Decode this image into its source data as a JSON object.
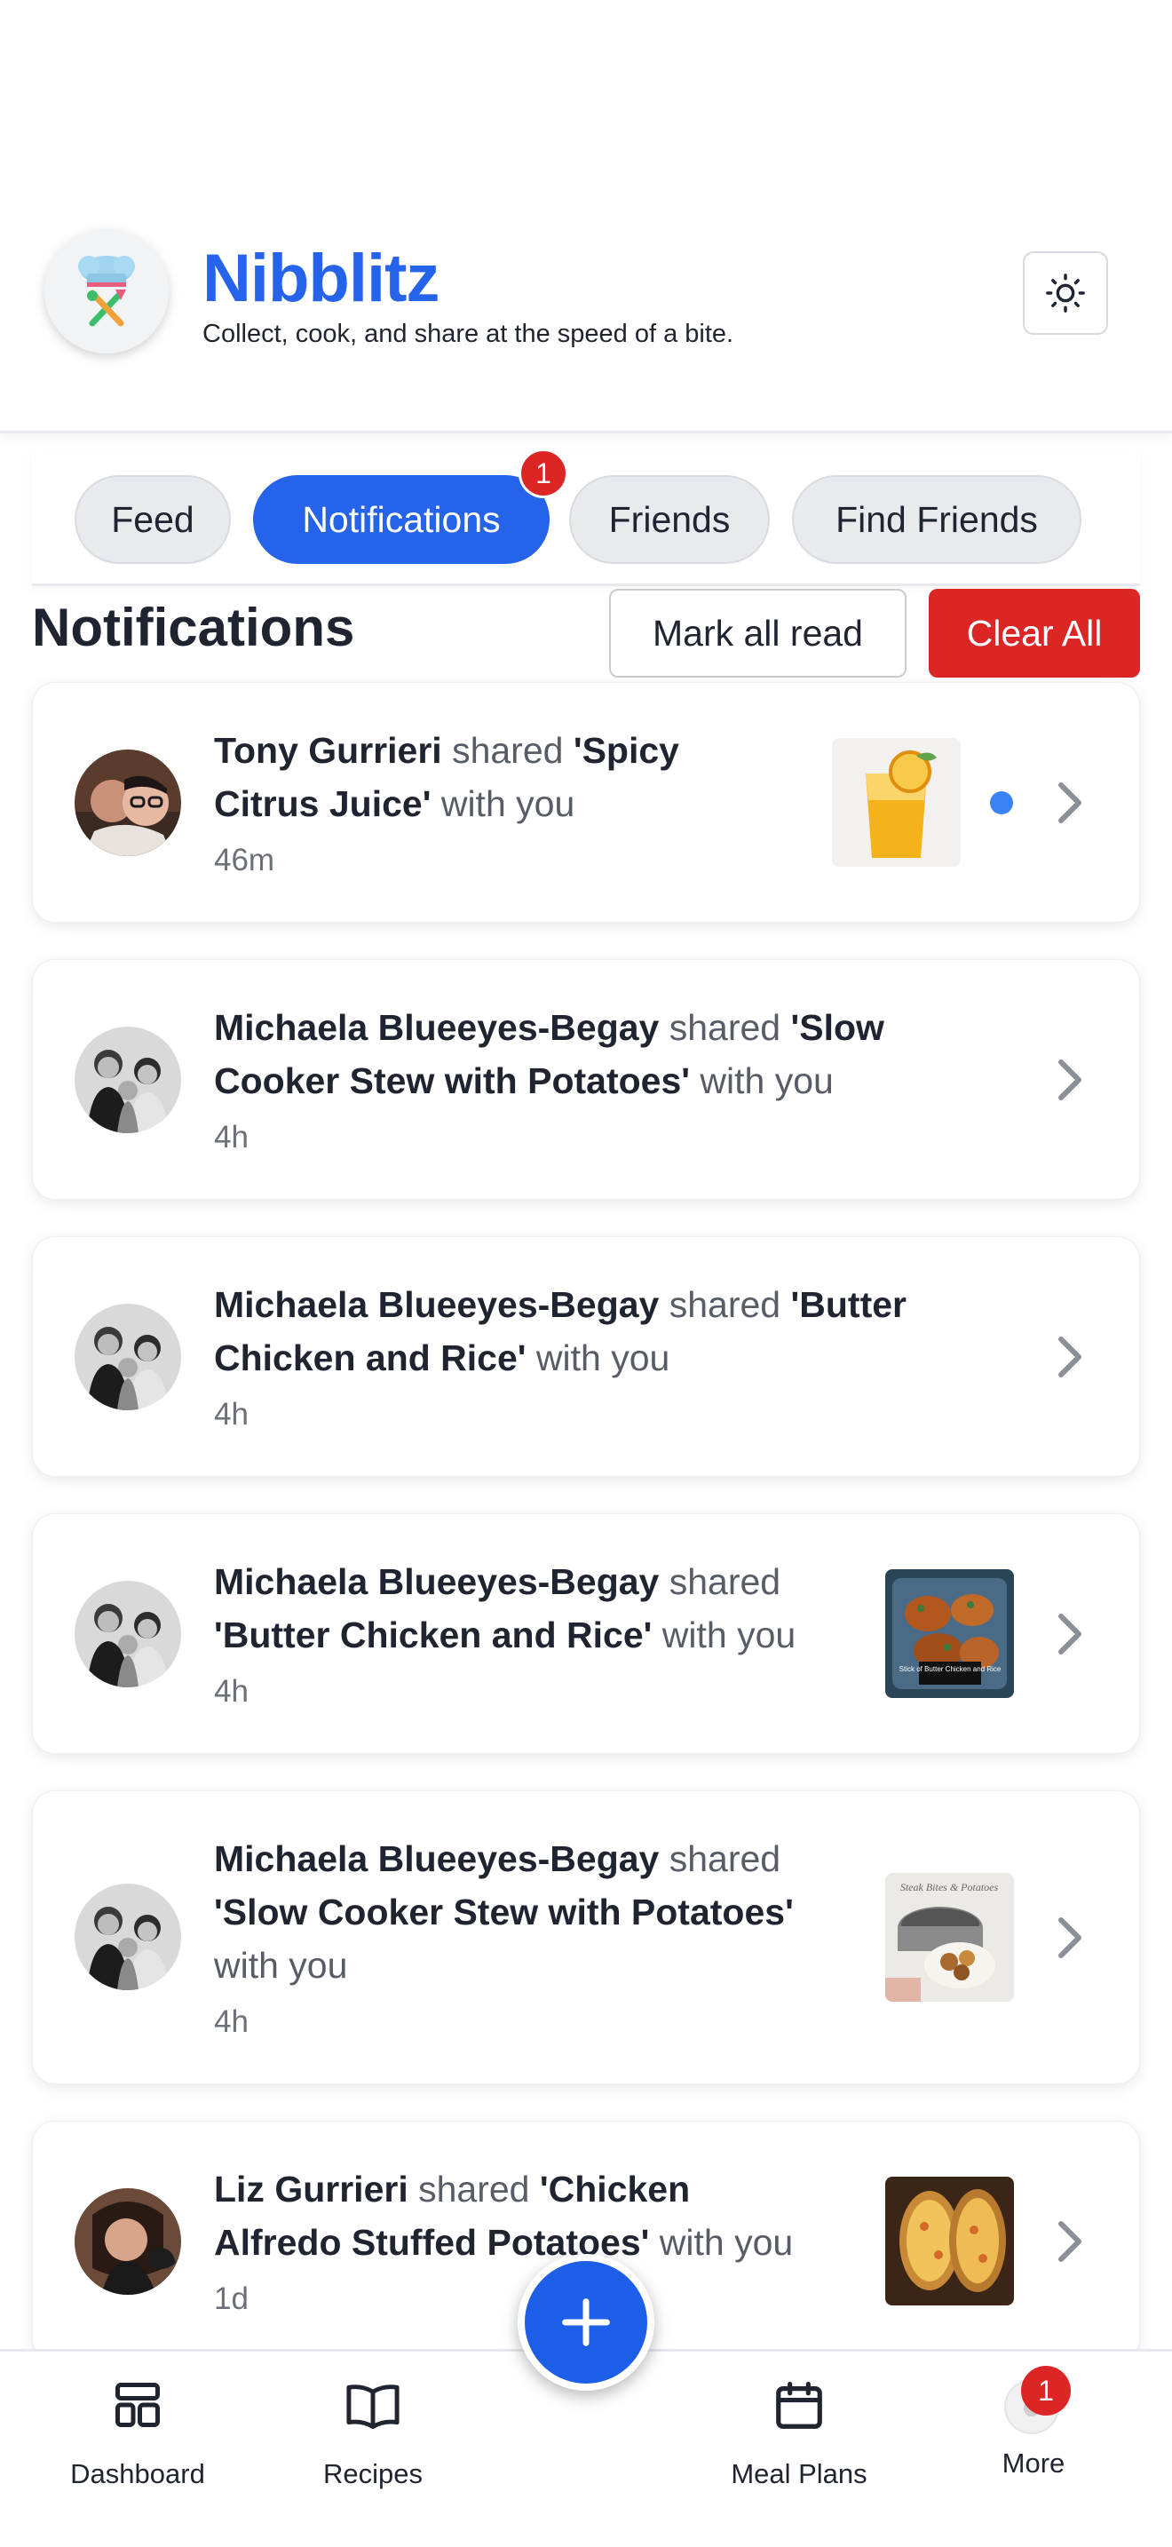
{
  "app": {
    "title": "Nibblitz",
    "subtitle": "Collect, cook, and share at the speed of a bite."
  },
  "tabs": [
    {
      "label": "Feed",
      "active": false
    },
    {
      "label": "Notifications",
      "active": true,
      "badge": "1"
    },
    {
      "label": "Friends",
      "active": false
    },
    {
      "label": "Find Friends",
      "active": false
    }
  ],
  "section": {
    "title": "Notifications",
    "mark_all_read": "Mark all read",
    "clear_all": "Clear All"
  },
  "notifications": [
    {
      "user": "Tony Gurrieri",
      "verb": " shared ",
      "recipe": "'Spicy",
      "recipe2": "Citrus Juice'",
      "suffix": " with you",
      "time": "46m",
      "unread": true
    },
    {
      "user": "Michaela Blueeyes-Begay",
      "verb": " shared ",
      "recipe": "'Slow",
      "recipe2": "Cooker Stew with Potatoes'",
      "suffix": " with you",
      "time": "4h",
      "unread": false
    },
    {
      "user": "Michaela Blueeyes-Begay",
      "verb": " shared ",
      "recipe": "'Butter",
      "recipe2": "Chicken and Rice'",
      "suffix": " with you",
      "time": "4h",
      "unread": false
    },
    {
      "user": "Michaela Blueeyes-Begay",
      "verb": " shared",
      "recipe": "'Butter Chicken and Rice'",
      "suffix": " with you",
      "time": "4h",
      "unread": false,
      "thumb_caption": "Stick of Butter Chicken and Rice"
    },
    {
      "user": "Michaela Blueeyes-Begay",
      "verb": " shared",
      "recipe": "'Slow Cooker Stew with Potatoes'",
      "suffix": "with you",
      "time": "4h",
      "unread": false,
      "thumb_caption": "Steak Bites & Potatoes"
    },
    {
      "user": "Liz Gurrieri",
      "verb": " shared ",
      "recipe": "'Chicken",
      "recipe2": "Alfredo Stuffed Potatoes'",
      "suffix": " with you",
      "time": "1d",
      "unread": false
    }
  ],
  "nav": {
    "dashboard": "Dashboard",
    "recipes": "Recipes",
    "meal_plans": "Meal Plans",
    "more": "More",
    "more_badge": "1"
  },
  "colors": {
    "brand": "#2563eb",
    "danger": "#dc2626",
    "unread_dot": "#3b82f6"
  }
}
